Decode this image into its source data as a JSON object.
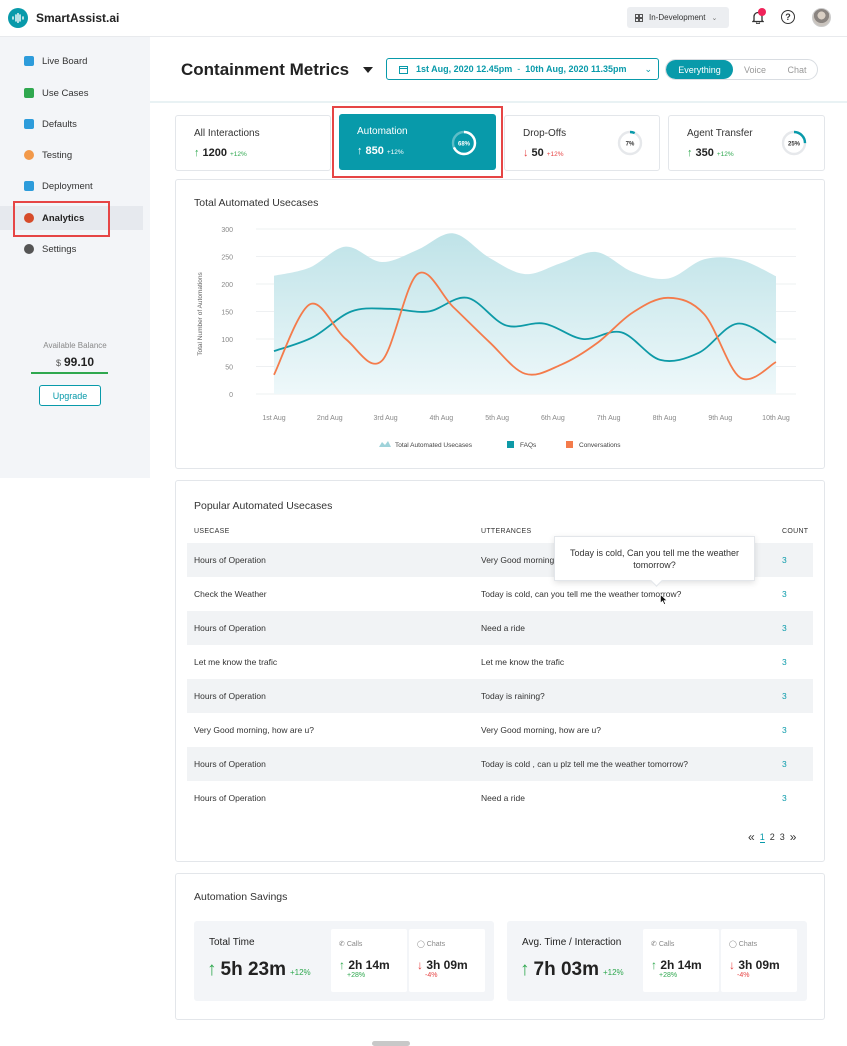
{
  "app": {
    "brand": "SmartAssist.ai",
    "environment": "In-Development"
  },
  "sidebar": {
    "items": [
      {
        "label": "Live Board",
        "icon": "live-board-icon",
        "color": "#2d9cdb"
      },
      {
        "label": "Use Cases",
        "icon": "use-cases-icon",
        "color": "#2fa84f"
      },
      {
        "label": "Defaults",
        "icon": "defaults-icon",
        "color": "#2d9cdb"
      },
      {
        "label": "Testing",
        "icon": "testing-icon",
        "color": "#f2994a"
      },
      {
        "label": "Deployment",
        "icon": "deployment-icon",
        "color": "#2d9cdb"
      },
      {
        "label": "Analytics",
        "icon": "analytics-icon",
        "color": "#d64b2a"
      },
      {
        "label": "Settings",
        "icon": "settings-icon",
        "color": "#555555"
      }
    ],
    "active": "Analytics",
    "balance_label": "Available Balance",
    "balance_currency": "$",
    "balance_value": "99.10",
    "upgrade_label": "Upgrade"
  },
  "header": {
    "title": "Containment Metrics",
    "date_from": "1st Aug, 2020",
    "time_from": "12.45pm",
    "date_sep": "-",
    "date_to": "10th Aug, 2020",
    "time_to": "11.35pm",
    "segments": [
      "Everything",
      "Voice",
      "Chat"
    ],
    "active_segment": "Everything"
  },
  "kpis": [
    {
      "title": "All Interactions",
      "value": "1200",
      "delta": "+12%",
      "trend": "up"
    },
    {
      "title": "Automation",
      "value": "850",
      "delta": "+12%",
      "trend": "up",
      "ring_label": "68%",
      "ring_pct": 68
    },
    {
      "title": "Drop-Offs",
      "value": "50",
      "delta": "+12%",
      "trend": "down",
      "ring_label": "7%",
      "ring_pct": 7
    },
    {
      "title": "Agent Transfer",
      "value": "350",
      "delta": "+12%",
      "trend": "up",
      "ring_label": "25%",
      "ring_pct": 25
    }
  ],
  "chart_data": {
    "type": "line",
    "title": "Total Automated Usecases",
    "ylabel": "Total Number of Automations",
    "xlabel": "",
    "categories": [
      "1st Aug",
      "2nd Aug",
      "3rd Aug",
      "4th Aug",
      "5th Aug",
      "6th Aug",
      "7th Aug",
      "8th Aug",
      "9th Aug",
      "10th Aug"
    ],
    "yticks": [
      0,
      50,
      100,
      150,
      200,
      250,
      300
    ],
    "ylim": [
      0,
      300
    ],
    "grid": true,
    "legend_position": "bottom",
    "series": [
      {
        "name": "Total Automated Usecases",
        "kind": "area",
        "color": "#bfe3e8",
        "values": [
          215,
          230,
          268,
          240,
          262,
          292,
          248,
          218,
          238,
          258,
          222,
          210,
          245,
          244,
          214
        ]
      },
      {
        "name": "FAQs",
        "kind": "line",
        "color": "#0e9aa7",
        "values": [
          78,
          103,
          150,
          155,
          150,
          175,
          125,
          128,
          100,
          112,
          62,
          75,
          128,
          93
        ]
      },
      {
        "name": "Conversations",
        "kind": "line",
        "color": "#f47b4b",
        "values": [
          35,
          163,
          100,
          60,
          218,
          158,
          95,
          37,
          53,
          92,
          148,
          175,
          145,
          30,
          58
        ]
      }
    ]
  },
  "usecases": {
    "title": "Popular Automated Usecases",
    "headers": [
      "USECASE",
      "UTTERANCES",
      "COUNT"
    ],
    "rows": [
      [
        "Hours of Operation",
        "Very Good morning, how are u?",
        "3"
      ],
      [
        "Check the Weather",
        "Today is cold, can you tell me the weather tomorrow?",
        "3"
      ],
      [
        "Hours of Operation",
        "Need a ride",
        "3"
      ],
      [
        "Let me know the trafic",
        "Let me know the trafic",
        "3"
      ],
      [
        "Hours of Operation",
        "Today is raining?",
        "3"
      ],
      [
        "Very Good morning, how are u?",
        "Very Good morning, how are u?",
        "3"
      ],
      [
        "Hours of Operation",
        "Today is cold , can u plz tell me the weather tomorrow?",
        "3"
      ],
      [
        "Hours of Operation",
        "Need a ride",
        "3"
      ]
    ],
    "tooltip": "Today is cold, Can you tell me the weather tomorrow?",
    "pages": [
      "1",
      "2",
      "3"
    ],
    "current_page": "1",
    "prev": "«",
    "next": "»"
  },
  "savings": {
    "title": "Automation Savings",
    "blocks": [
      {
        "label": "Total Time",
        "value": "5h 23m",
        "delta": "+12%",
        "calls_label": "Calls",
        "calls_value": "2h 14m",
        "calls_delta": "+28%",
        "chats_label": "Chats",
        "chats_value": "3h 09m",
        "chats_delta": "-4%"
      },
      {
        "label": "Avg. Time / Interaction",
        "value": "7h 03m",
        "delta": "+12%",
        "calls_label": "Calls",
        "calls_value": "2h 14m",
        "calls_delta": "+28%",
        "chats_label": "Chats",
        "chats_value": "3h 09m",
        "chats_delta": "-4%"
      }
    ]
  }
}
